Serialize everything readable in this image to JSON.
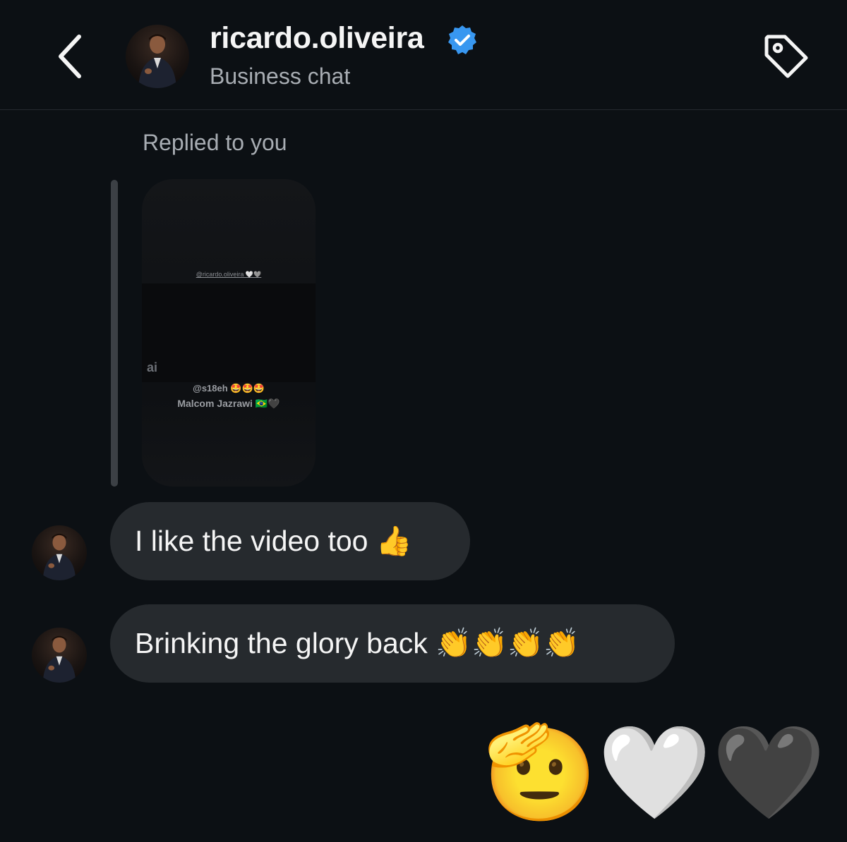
{
  "header": {
    "username": "ricardo.oliveira",
    "subtitle": "Business chat",
    "verified": true,
    "icons": {
      "back": "chevron-left-icon",
      "tag": "tag-icon",
      "verified": "verified-badge-icon"
    },
    "accent_color": "#3897f0"
  },
  "reply_context": {
    "label": "Replied to you",
    "story": {
      "top_mention": "@ricardo.oliveira 🤍🩶",
      "corner_mark": "ai",
      "mention": "@s18eh 🤩🤩🤩",
      "name": "Malcom Jazrawi 🇧🇷🖤"
    }
  },
  "messages": [
    {
      "text": "I like the video too 👍"
    },
    {
      "text": "Brinking the glory back 👏👏👏👏"
    }
  ],
  "reaction": {
    "emojis": "🫡🤍🖤"
  },
  "colors": {
    "background": "#0c1014",
    "bubble": "#262a2e",
    "secondary_text": "#a8adb3"
  }
}
